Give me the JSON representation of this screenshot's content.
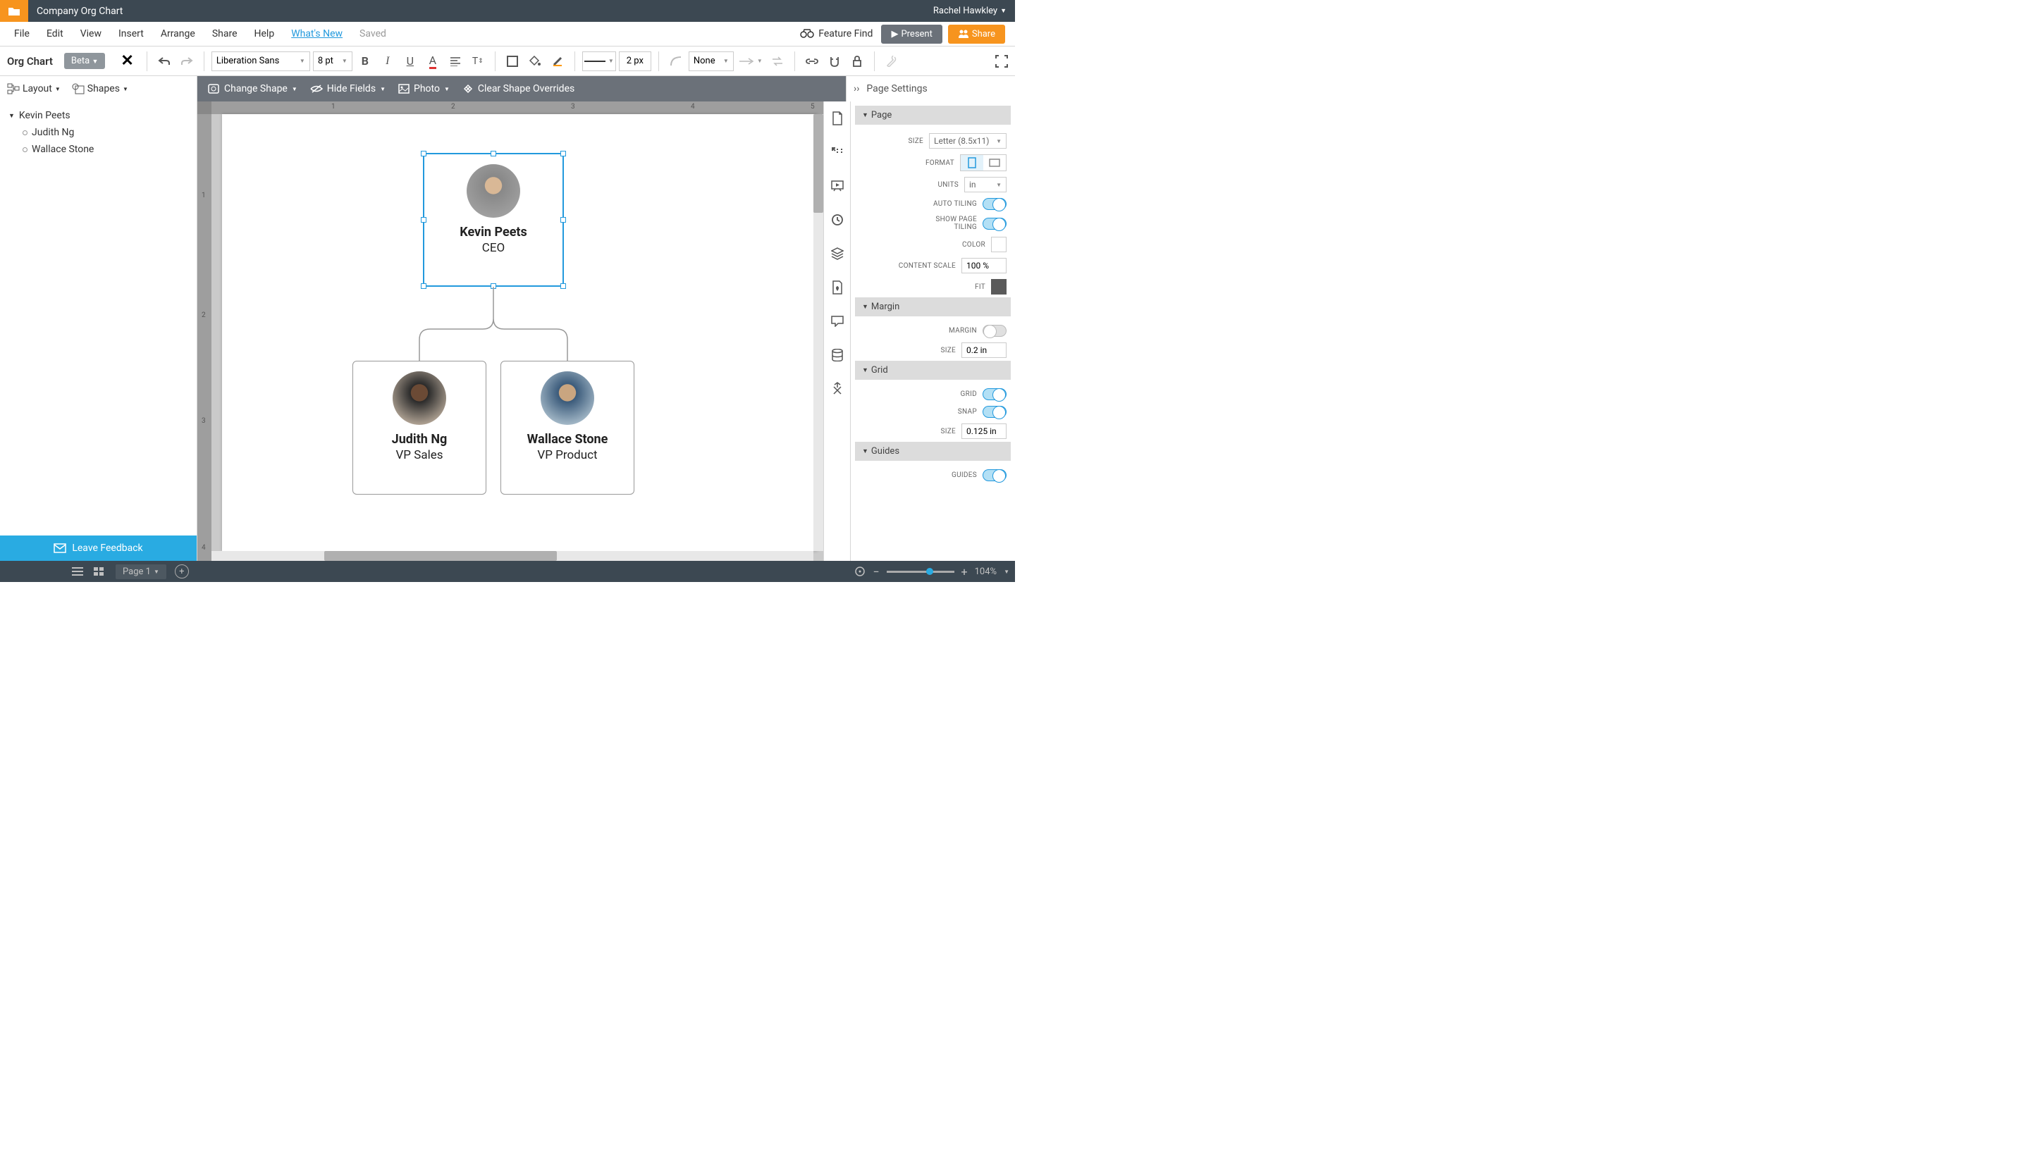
{
  "header": {
    "doc_title": "Company Org Chart",
    "user_name": "Rachel Hawkley"
  },
  "menu": {
    "items": [
      "File",
      "Edit",
      "View",
      "Insert",
      "Arrange",
      "Share",
      "Help"
    ],
    "whats_new": "What's New",
    "saved": "Saved",
    "feature_find": "Feature Find",
    "present": "Present",
    "share": "Share"
  },
  "toolbar": {
    "title": "Org Chart",
    "beta": "Beta",
    "font": "Liberation Sans",
    "font_size": "8 pt",
    "line_width": "2 px",
    "none": "None"
  },
  "subtoolbar": {
    "layout": "Layout",
    "shapes": "Shapes",
    "change_shape": "Change Shape",
    "hide_fields": "Hide Fields",
    "photo": "Photo",
    "clear": "Clear Shape Overrides",
    "panel_title": "Page Settings"
  },
  "tree": {
    "root": "Kevin Peets",
    "children": [
      "Judith Ng",
      "Wallace Stone"
    ]
  },
  "feedback": "Leave Feedback",
  "org": {
    "ceo": {
      "name": "Kevin Peets",
      "title": "CEO"
    },
    "vp1": {
      "name": "Judith Ng",
      "title": "VP Sales"
    },
    "vp2": {
      "name": "Wallace Stone",
      "title": "VP Product"
    }
  },
  "settings": {
    "sections": {
      "page": "Page",
      "margin": "Margin",
      "grid": "Grid",
      "guides": "Guides"
    },
    "labels": {
      "size": "SIZE",
      "format": "FORMAT",
      "units": "UNITS",
      "auto_tiling": "AUTO TILING",
      "show_page_tiling": "SHOW PAGE TILING",
      "color": "COLOR",
      "content_scale": "CONTENT SCALE",
      "fit": "FIT",
      "margin": "MARGIN",
      "grid": "GRID",
      "snap": "SNAP",
      "guides": "GUIDES"
    },
    "page_size": "Letter (8.5x11)",
    "units": "in",
    "content_scale": "100 %",
    "margin_size": "0.2 in",
    "grid_size": "0.125 in"
  },
  "bottom": {
    "page": "Page 1",
    "zoom": "104%"
  },
  "ruler_ticks_h": [
    "1",
    "2",
    "3",
    "4",
    "5"
  ],
  "ruler_ticks_v": [
    "1",
    "2",
    "3",
    "4"
  ]
}
